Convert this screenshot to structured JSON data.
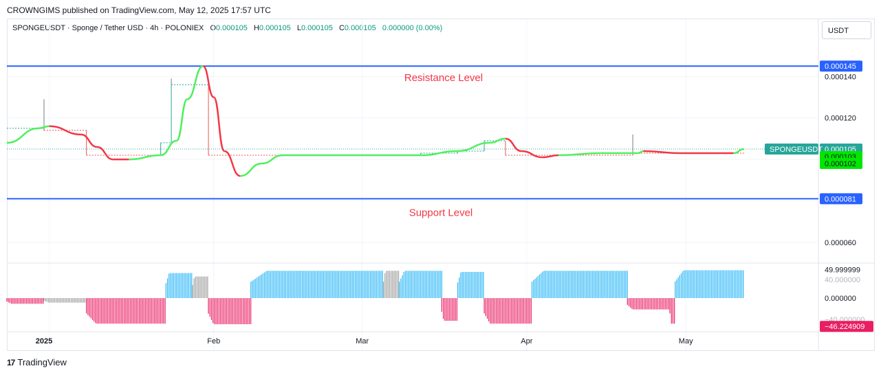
{
  "publisher": "CROWNGIMS published on TradingView.com, May 12, 2025 17:57 UTC",
  "legend": {
    "symbol": "SPONGEUSDT · Sponge / Tether USD · 4h · POLONIEX",
    "open_label": "O",
    "open": "0.000105",
    "high_label": "H",
    "high": "0.000105",
    "low_label": "L",
    "low": "0.000105",
    "close_label": "C",
    "close": "0.000105",
    "change": "0.000000 (0.00%)"
  },
  "currency": "USDT",
  "footer_brand": "TradingView",
  "annotations": {
    "resistance": "Resistance Level",
    "support": "Support Level"
  },
  "price_axis": {
    "ticks": [
      "0.000140",
      "0.000120",
      "0.000060"
    ],
    "tag_resistance": "0.000145",
    "tag_support": "0.000081",
    "tag_symbol": "SPONGEUSDT",
    "tag_last": "0.000105",
    "tag_green_1": "0.000103",
    "tag_green_2": "0.000102"
  },
  "osc_axis": {
    "ticks": [
      "49.999999",
      "0.000000"
    ],
    "tag_neg": "−46.224909",
    "ghost_top": "40.000000",
    "ghost_bottom": "−40.000000"
  },
  "time_axis": [
    "2025",
    "Feb",
    "Mar",
    "Apr",
    "May"
  ],
  "colors": {
    "resistance_line": "#2962ff",
    "support_line": "#2962ff",
    "annotation_text": "#f23645",
    "ma_up": "#4cf05c",
    "ma_down": "#f23645",
    "step_up": "#26a69a",
    "step_down": "#ef5350",
    "osc_up": "#29b6f6",
    "osc_down": "#e91e63",
    "osc_neutral": "#9e9e9e",
    "last_price": "#26a69a"
  },
  "chart_data": {
    "type": "line",
    "symbol": "SPONGEUSDT",
    "timeframe": "4h",
    "y_range": [
      5e-05,
      0.000157
    ],
    "resistance": 0.000145,
    "support": 8.1e-05,
    "ma_points": [
      [
        "2024-12-24",
        0.000108,
        "up"
      ],
      [
        "2024-12-30",
        0.000115,
        "up"
      ],
      [
        "2025-01-01",
        0.000116,
        "down"
      ],
      [
        "2025-01-07",
        0.000112,
        "down"
      ],
      [
        "2025-01-10",
        0.000106,
        "down"
      ],
      [
        "2025-01-13",
        0.0001,
        "down"
      ],
      [
        "2025-01-16",
        0.0001,
        "up"
      ],
      [
        "2025-01-22",
        0.000102,
        "up"
      ],
      [
        "2025-01-25",
        0.000109,
        "up"
      ],
      [
        "2025-01-27",
        0.000129,
        "up"
      ],
      [
        "2025-01-30",
        0.000145,
        "down"
      ],
      [
        "2025-02-01",
        0.00013,
        "down"
      ],
      [
        "2025-02-03",
        0.000104,
        "down"
      ],
      [
        "2025-02-06",
        9.2e-05,
        "up"
      ],
      [
        "2025-02-10",
        9.8e-05,
        "up"
      ],
      [
        "2025-02-14",
        0.000102,
        "up"
      ],
      [
        "2025-03-12",
        0.000102,
        "up"
      ],
      [
        "2025-03-19",
        0.000104,
        "up"
      ],
      [
        "2025-03-25",
        0.000108,
        "up"
      ],
      [
        "2025-03-28",
        0.00011,
        "down"
      ],
      [
        "2025-03-31",
        0.000104,
        "down"
      ],
      [
        "2025-04-04",
        0.000101,
        "down"
      ],
      [
        "2025-04-07",
        0.000102,
        "up"
      ],
      [
        "2025-04-15",
        0.000103,
        "up"
      ],
      [
        "2025-04-22",
        0.000103,
        "up"
      ],
      [
        "2025-04-23",
        0.000104,
        "down"
      ],
      [
        "2025-04-30",
        0.000103,
        "down"
      ],
      [
        "2025-05-10",
        0.000103,
        "up"
      ],
      [
        "2025-05-12",
        0.000105,
        "up"
      ]
    ],
    "step_segments": [
      [
        "2024-12-24",
        "2024-12-31",
        0.000115,
        "up"
      ],
      [
        "2024-12-31",
        "2025-01-08",
        0.000114,
        "down"
      ],
      [
        "2025-01-08",
        "2025-01-22",
        0.000102,
        "down"
      ],
      [
        "2025-01-22",
        "2025-01-24",
        0.000108,
        "up"
      ],
      [
        "2025-01-24",
        "2025-01-31",
        0.000136,
        "up"
      ],
      [
        "2025-01-31",
        "2025-03-12",
        0.000102,
        "down"
      ],
      [
        "2025-03-12",
        "2025-03-19",
        0.000103,
        "up"
      ],
      [
        "2025-03-19",
        "2025-03-24",
        0.000104,
        "up"
      ],
      [
        "2025-03-24",
        "2025-03-28",
        0.000109,
        "up"
      ],
      [
        "2025-03-28",
        "2025-04-21",
        0.000102,
        "down"
      ],
      [
        "2025-04-21",
        "2025-05-12",
        0.000103,
        "down"
      ]
    ],
    "wicks": [
      [
        "2024-12-31",
        0.000129
      ],
      [
        "2025-01-24",
        0.000139
      ],
      [
        "2025-04-21",
        0.000112
      ]
    ],
    "last_price": 0.000105,
    "oscillator": {
      "y_range": [
        -58,
        58
      ],
      "segments": [
        [
          "2024-12-24",
          "2024-12-31",
          -10,
          "down"
        ],
        [
          "2024-12-31",
          "2025-01-08",
          -8,
          "neutral"
        ],
        [
          "2025-01-08",
          "2025-01-23",
          -45,
          "down"
        ],
        [
          "2025-01-23",
          "2025-01-28",
          44,
          "up"
        ],
        [
          "2025-01-28",
          "2025-01-31",
          38,
          "neutral"
        ],
        [
          "2025-01-31",
          "2025-02-08",
          -46,
          "down"
        ],
        [
          "2025-02-08",
          "2025-03-05",
          48,
          "up"
        ],
        [
          "2025-03-05",
          "2025-03-08",
          48,
          "neutral"
        ],
        [
          "2025-03-08",
          "2025-03-16",
          48,
          "up"
        ],
        [
          "2025-03-16",
          "2025-03-19",
          -40,
          "down"
        ],
        [
          "2025-03-19",
          "2025-03-24",
          46,
          "up"
        ],
        [
          "2025-03-24",
          "2025-04-02",
          -45,
          "down"
        ],
        [
          "2025-04-02",
          "2025-04-20",
          48,
          "up"
        ],
        [
          "2025-04-20",
          "2025-04-28",
          -20,
          "down"
        ],
        [
          "2025-04-28",
          "2025-04-29",
          -45,
          "down"
        ],
        [
          "2025-04-29",
          "2025-05-12",
          49,
          "up"
        ]
      ]
    }
  }
}
